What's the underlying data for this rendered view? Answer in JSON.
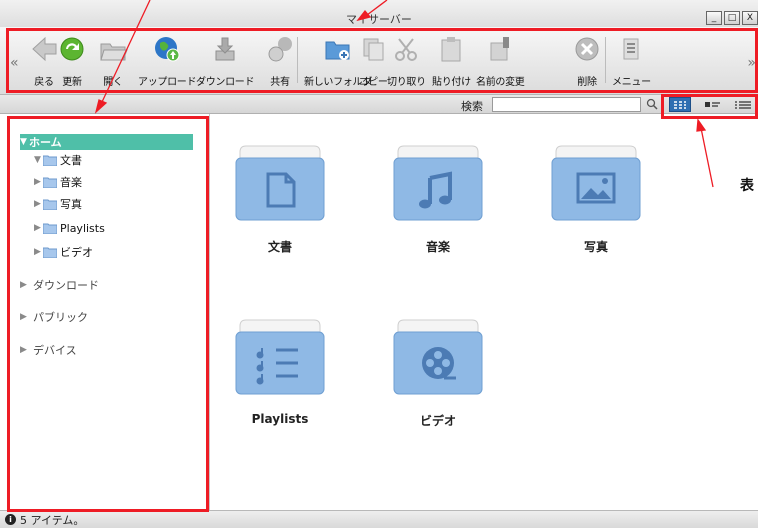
{
  "window": {
    "title": "マイサーバー"
  },
  "toolbar": {
    "items": [
      {
        "id": "back",
        "label": "戻る",
        "icon": "back-arrow-icon"
      },
      {
        "id": "refresh",
        "label": "更新",
        "icon": "refresh-icon"
      },
      {
        "id": "open",
        "label": "開く",
        "icon": "open-folder-icon"
      },
      {
        "id": "upload",
        "label": "アップロード",
        "icon": "upload-globe-icon"
      },
      {
        "id": "download",
        "label": "ダウンロード",
        "icon": "download-icon"
      },
      {
        "id": "share",
        "label": "共有",
        "icon": "share-icon"
      },
      {
        "id": "new_folder",
        "label": "新しいフォルダ",
        "icon": "new-folder-icon"
      },
      {
        "id": "copy",
        "label": "コピー",
        "icon": "copy-icon"
      },
      {
        "id": "cut",
        "label": "切り取り",
        "icon": "cut-icon"
      },
      {
        "id": "paste",
        "label": "貼り付け",
        "icon": "paste-icon"
      },
      {
        "id": "rename",
        "label": "名前の変更",
        "icon": "rename-icon"
      },
      {
        "id": "delete",
        "label": "削除",
        "icon": "delete-icon"
      },
      {
        "id": "menu",
        "label": "メニュー",
        "icon": "menu-icon"
      }
    ]
  },
  "search": {
    "label": "検索",
    "value": ""
  },
  "sidebar": {
    "home": "ホーム",
    "home_children": [
      "文書",
      "音楽",
      "写真",
      "Playlists",
      "ビデオ"
    ],
    "sections": [
      "ダウンロード",
      "パブリック",
      "デバイス"
    ]
  },
  "folders": [
    {
      "label": "文書",
      "icon": "document-icon"
    },
    {
      "label": "音楽",
      "icon": "music-note-icon"
    },
    {
      "label": "写真",
      "icon": "picture-icon"
    },
    {
      "label": "Playlists",
      "icon": "playlist-icon"
    },
    {
      "label": "ビデオ",
      "icon": "film-reel-icon"
    }
  ],
  "status": {
    "text": "5 アイテム。"
  },
  "annotation": {
    "text": "表"
  },
  "colors": {
    "highlight": "#4fbfa8",
    "folder": "#8fb9e5",
    "callout": "#ee1c25",
    "view_active": "#2f6fb2"
  }
}
